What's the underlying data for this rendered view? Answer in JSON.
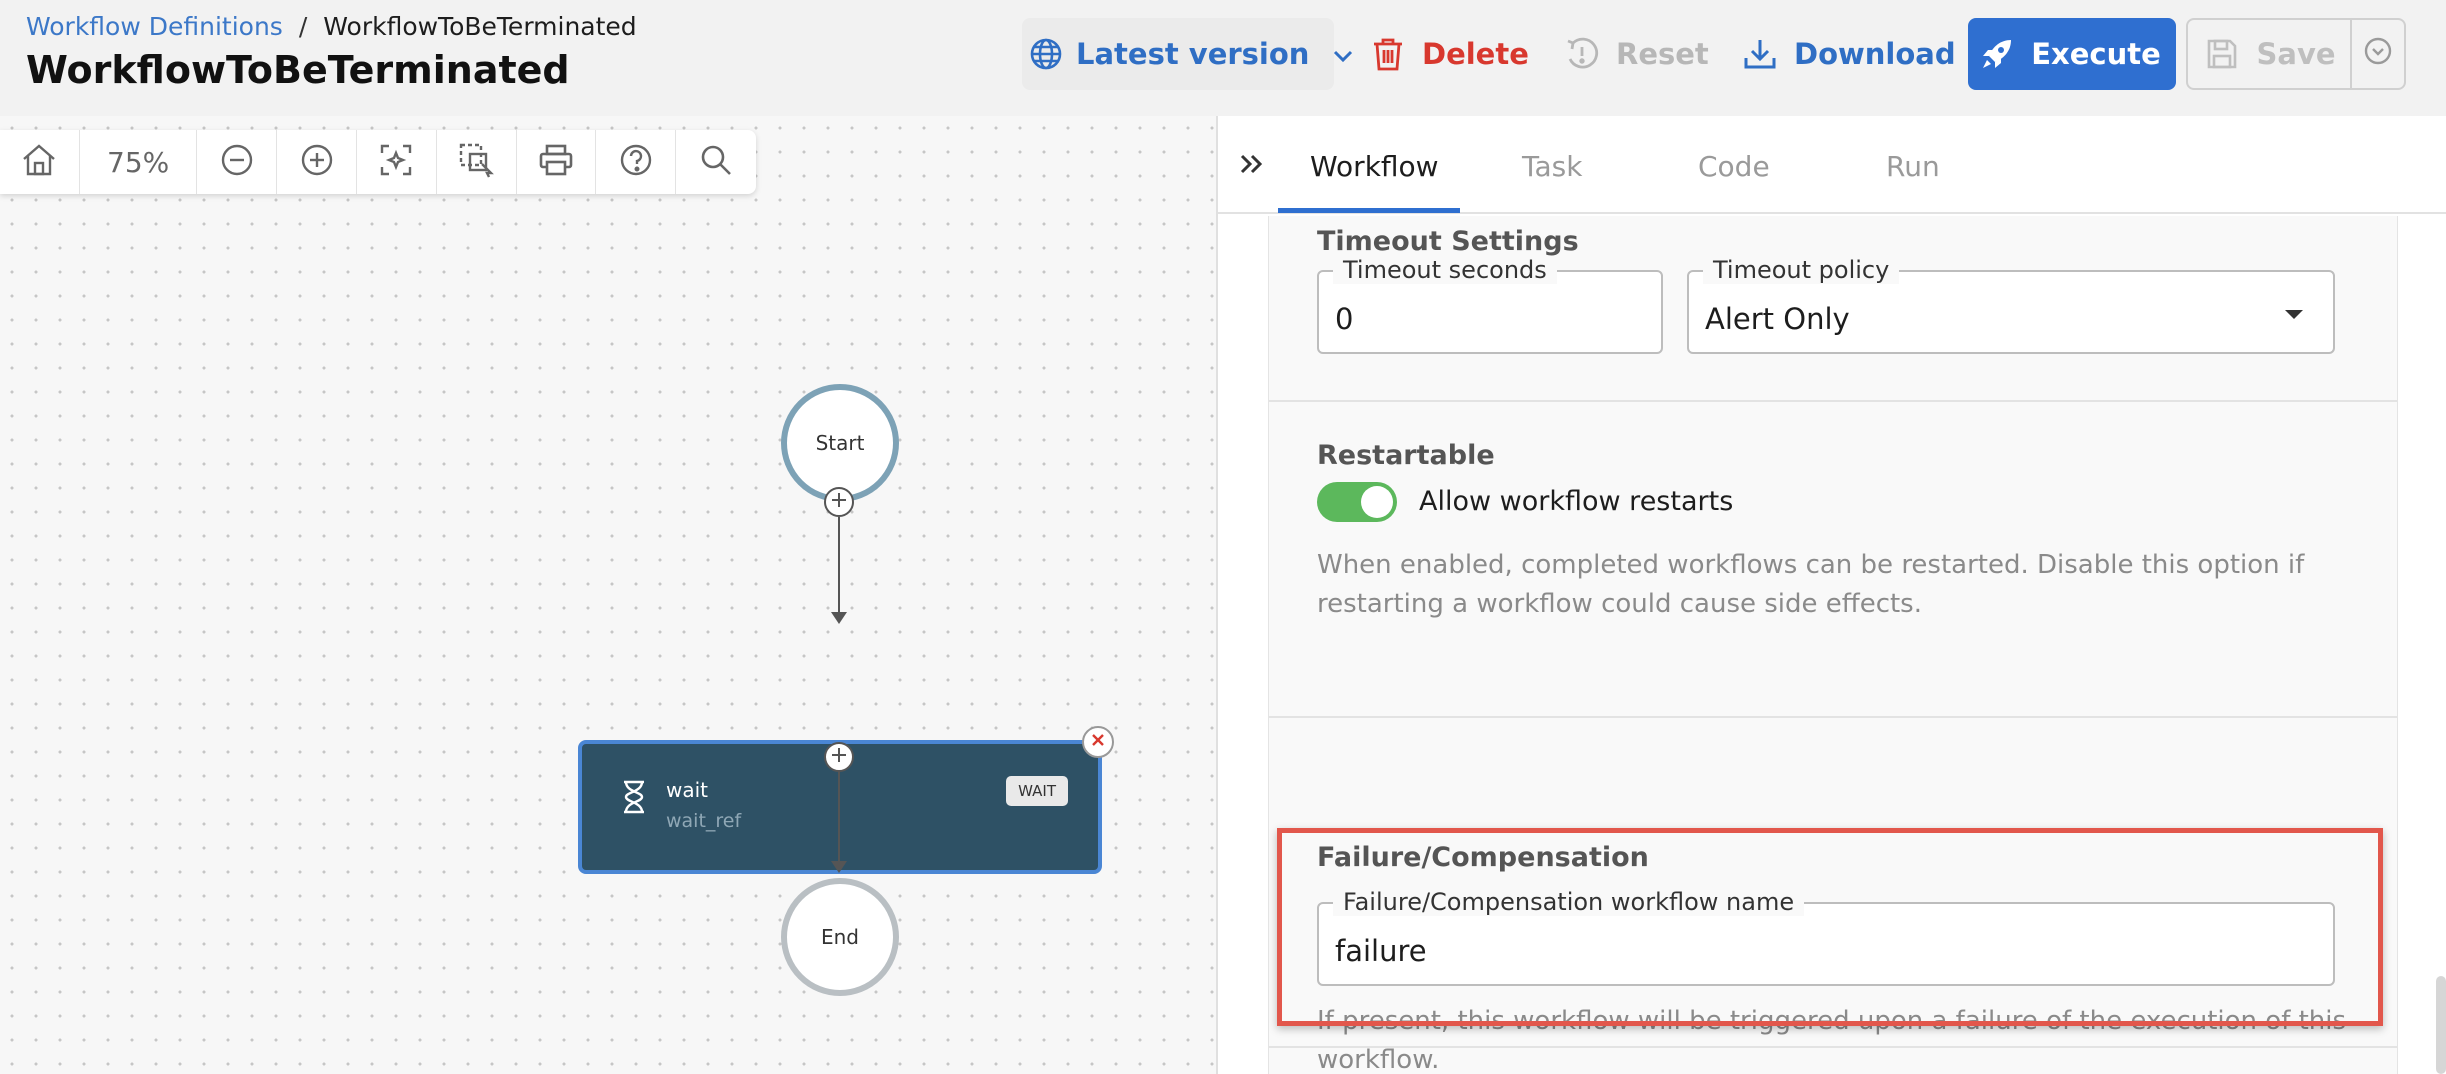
{
  "header": {
    "breadcrumb_link": "Workflow Definitions",
    "breadcrumb_sep": "/",
    "breadcrumb_current": "WorkflowToBeTerminated",
    "title": "WorkflowToBeTerminated",
    "version_label": "Latest version",
    "delete_label": "Delete",
    "reset_label": "Reset",
    "download_label": "Download",
    "execute_label": "Execute",
    "save_label": "Save"
  },
  "toolbar": {
    "zoom": "75%",
    "icons": [
      "home-icon",
      "zoom-out-icon",
      "zoom-in-icon",
      "fit-view-icon",
      "select-area-icon",
      "print-icon",
      "help-icon",
      "search-icon"
    ]
  },
  "graph": {
    "start_label": "Start",
    "end_label": "End",
    "task": {
      "name": "wait",
      "ref": "wait_ref",
      "type": "WAIT"
    }
  },
  "panel": {
    "tabs": [
      {
        "label": "Workflow",
        "active": true
      },
      {
        "label": "Task",
        "active": false
      },
      {
        "label": "Code",
        "active": false
      },
      {
        "label": "Run",
        "active": false
      }
    ],
    "timeout": {
      "title": "Timeout Settings",
      "seconds_label": "Timeout seconds",
      "seconds_value": "0",
      "policy_label": "Timeout policy",
      "policy_value": "Alert Only"
    },
    "restartable": {
      "title": "Restartable",
      "toggle_label": "Allow workflow restarts",
      "enabled": true,
      "help": "When enabled, completed workflows can be restarted. Disable this option if restarting a workflow could cause side effects."
    },
    "failure": {
      "title": "Failure/Compensation",
      "field_label": "Failure/Compensation workflow name",
      "field_value": "failure",
      "help": "If present, this workflow will be triggered upon a failure of the execution of this workflow."
    }
  },
  "colors": {
    "accent": "#2f6fd0",
    "delete": "#d8382e",
    "highlight": "#e2574c",
    "toggle_on": "#5cb85c",
    "task_bg": "#2e5165"
  }
}
